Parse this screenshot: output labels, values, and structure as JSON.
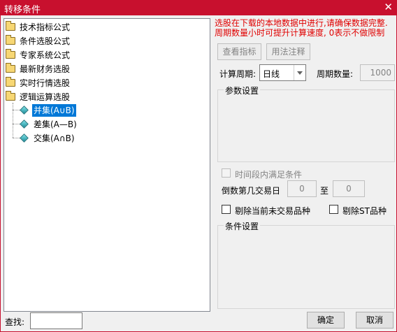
{
  "window": {
    "title": "转移条件",
    "close_glyph": "✕"
  },
  "tree": {
    "folders": [
      {
        "label": "技术指标公式"
      },
      {
        "label": "条件选股公式"
      },
      {
        "label": "专家系统公式"
      },
      {
        "label": "最新财务选股"
      },
      {
        "label": "实时行情选股"
      },
      {
        "label": "逻辑运算选股"
      }
    ],
    "leaves": [
      {
        "label": "并集(A∪B)",
        "selected": true
      },
      {
        "label": "差集(A—B)",
        "selected": false
      },
      {
        "label": "交集(A∩B)",
        "selected": false
      }
    ]
  },
  "notice": {
    "line1": "选股在下载的本地数据中进行,请确保数据完整.",
    "line2": "周期数量小时可提升计算速度, 0表示不做限制"
  },
  "buttons": {
    "view_indicator": "查看指标",
    "usage_notes": "用法注释",
    "ok": "确定",
    "cancel": "取消"
  },
  "period": {
    "label": "计算周期:",
    "value": "日线",
    "count_label": "周期数量:",
    "count_value": "1000"
  },
  "params": {
    "legend": "参数设置"
  },
  "time_condition": {
    "label": "时间段内满足条件",
    "checked": false,
    "enabled": false
  },
  "reverse_day": {
    "label": "倒数第几交易日",
    "from": "0",
    "to_label": "至",
    "to": "0"
  },
  "excludes": {
    "untraded_label": "剔除当前未交易品种",
    "st_label": "剔除ST品种"
  },
  "conditions": {
    "legend": "条件设置"
  },
  "search": {
    "label": "查找:",
    "value": ""
  },
  "colors": {
    "title_bar": "#c8102e",
    "notice_text": "#e00000",
    "selection": "#0078d7"
  }
}
